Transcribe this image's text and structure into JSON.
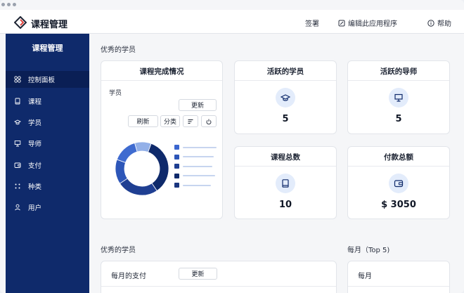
{
  "app": {
    "title": "课程管理"
  },
  "topbar": {
    "sign_label": "签署",
    "edit_label": "编辑此应用程序",
    "help_label": "帮助"
  },
  "sidebar": {
    "title": "课程管理",
    "items": [
      {
        "label": "控制面板",
        "icon": "dashboard-icon",
        "active": true
      },
      {
        "label": "课程",
        "icon": "book-icon",
        "active": false
      },
      {
        "label": "学员",
        "icon": "graduation-cap-icon",
        "active": false
      },
      {
        "label": "导师",
        "icon": "presentation-board-icon",
        "active": false
      },
      {
        "label": "支付",
        "icon": "wallet-icon",
        "active": false
      },
      {
        "label": "种类",
        "icon": "category-dots-icon",
        "active": false
      },
      {
        "label": "用户",
        "icon": "user-icon",
        "active": false
      }
    ]
  },
  "main": {
    "section1_title": "优秀的学员",
    "completion": {
      "title": "课程完成情况",
      "subtitle": "学员",
      "update_label": "更新",
      "refresh_label": "刷新",
      "category_label": "分类"
    },
    "active_students": {
      "title": "活跃的学员",
      "value": "5"
    },
    "active_mentors": {
      "title": "活跃的导师",
      "value": "5"
    },
    "total_courses": {
      "title": "课程总数",
      "value": "10"
    },
    "total_payment": {
      "title": "付款总额",
      "value": "$ 3050"
    },
    "section2_title": "优秀的学员",
    "section3_title": "每月（Top 5)",
    "monthly_pay": {
      "title": "每月的支付",
      "update_label": "更新"
    },
    "monthly": {
      "title": "每月"
    }
  },
  "chart_data": {
    "type": "pie",
    "donut": true,
    "values": [
      35,
      25,
      15,
      15,
      10
    ],
    "colors": [
      "#0f2a6b",
      "#1f3f92",
      "#2d56b8",
      "#3f6bd0",
      "#93b0e8"
    ],
    "legend_colors": [
      "#3b66cf",
      "#2d56b8",
      "#1f3f92",
      "#0f2a6b",
      "#1a367f"
    ]
  },
  "colors": {
    "primary": "#0f2a6b",
    "icon_bg": "#e3ecfb",
    "accent": "#1e4fb8"
  }
}
